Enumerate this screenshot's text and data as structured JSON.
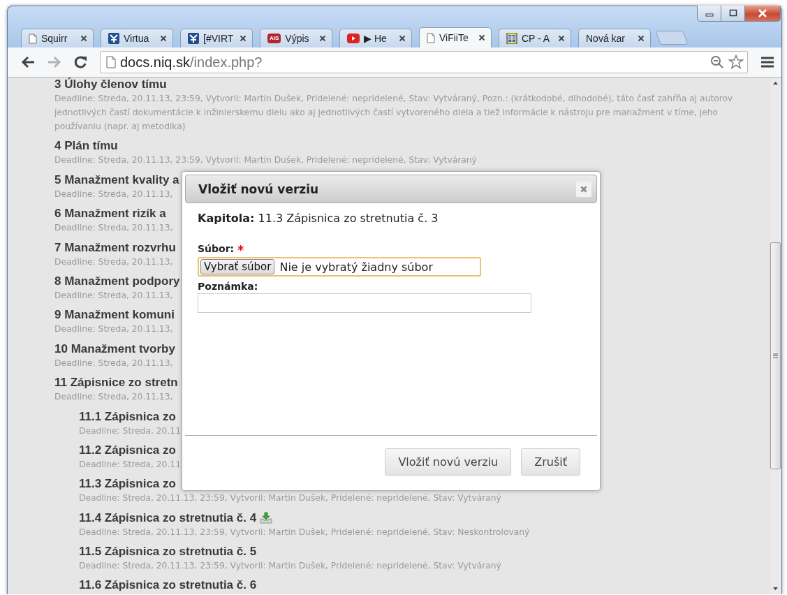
{
  "browser": {
    "tabs": [
      {
        "kind": "page",
        "label": "Squirr",
        "selected": false
      },
      {
        "kind": "mark",
        "label": "Virtua",
        "selected": false
      },
      {
        "kind": "mark",
        "label": "[#VIRT",
        "selected": false
      },
      {
        "kind": "badge",
        "badge": "AIS",
        "label": "Výpis",
        "selected": false
      },
      {
        "kind": "play",
        "label": "▶ He",
        "selected": false
      },
      {
        "kind": "page",
        "label": "ViFiiTe",
        "selected": true
      },
      {
        "kind": "sheet",
        "label": "CP - A",
        "selected": false
      },
      {
        "kind": "plain",
        "label": "Nová kar",
        "selected": false
      }
    ],
    "nav": [
      {
        "kind": "back",
        "disabled": false
      },
      {
        "kind": "forward",
        "disabled": true
      },
      {
        "kind": "reload",
        "disabled": false
      }
    ],
    "address": {
      "host": "docs.niq.sk",
      "path": "/index.php?"
    }
  },
  "chapters": [
    {
      "title": "3 Úlohy členov tímu",
      "deadline": "Deadline: Streda, 20.11.13, 23:59, Vytvoril: Martin Dušek, Pridelené: nepridelené, Stav: Vytváraný, Pozn.: (krátkodobé, dlhodobé), táto časť zahŕňa aj autorov jednotlivých častí dokumentácie k inžinierskemu dielu ako aj jednotlivých častí vytvoreného diela a tiež informácie k nástroju pre manažment v tíme, jeho používaniu (napr. aj metodika)",
      "has_file": false
    },
    {
      "title": "4 Plán tímu",
      "deadline": "Deadline: Streda, 20.11.13, 23:59, Vytvoril: Martin Dušek, Pridelené: nepridelené, Stav: Vytváraný",
      "has_file": false
    },
    {
      "title": "5 Manažment kvality a",
      "deadline": "Deadline: Streda, 20.11.13,",
      "has_file": false
    },
    {
      "title": "6 Manažment rizík a",
      "deadline": "Deadline: Streda, 20.11.13,",
      "has_file": false
    },
    {
      "title": "7 Manažment rozvrhu",
      "deadline": "Deadline: Streda, 20.11.13,",
      "has_file": false
    },
    {
      "title": "8 Manažment podpory",
      "deadline": "Deadline: Streda, 20.11.13,",
      "has_file": false
    },
    {
      "title": "9 Manažment komuni",
      "deadline": "Deadline: Streda, 20.11.13,",
      "has_file": false
    },
    {
      "title": "10 Manažment tvorby",
      "deadline": "Deadline: Streda, 20.11.13,",
      "has_file": false
    },
    {
      "title": "11 Zápisnice zo stretn",
      "deadline": "Deadline: Streda, 20.11.13,",
      "has_file": false,
      "children": [
        {
          "title": "11.1 Zápisnica zo",
          "deadline": "Deadline: Streda, 20.11",
          "has_file": false
        },
        {
          "title": "11.2 Zápisnica zo",
          "deadline": "Deadline: Streda, 20.11",
          "has_file": false
        },
        {
          "title": "11.3 Zápisnica zo",
          "deadline": "Deadline: Streda, 20.11.13, 23:59, Vytvoril: Martin Dušek, Pridelené: nepridelené, Stav: Vytváraný",
          "has_file": false
        },
        {
          "title": "11.4 Zápisnica zo stretnutia č. 4",
          "deadline": "Deadline: Streda, 20.11.13, 23:59, Vytvoril: Martin Dušek, Pridelené: nepridelené, Stav: Neskontrolovaný",
          "has_file": true
        },
        {
          "title": "11.5 Zápisnica zo stretnutia č. 5",
          "deadline": "Deadline: Streda, 20.11.13, 23:59, Vytvoril: Martin Dušek, Pridelené: nepridelené, Stav: Vytváraný",
          "has_file": false
        },
        {
          "title": "11.6 Zápisnica zo stretnutia č. 6",
          "has_file": false
        }
      ]
    }
  ],
  "dialog": {
    "title": "Vložiť novú verziu",
    "chapter": "**Kapitola:** 11.3 Zápisnica zo stretnutia č. 3",
    "required_mark": "*",
    "fields": [
      {
        "kind": "file",
        "label": "Súbor:",
        "required": true,
        "focused": true,
        "button": "Vybrať súbor",
        "value": "Nie je vybratý žiadny súbor"
      },
      {
        "kind": "text",
        "label": "Poznámka:",
        "required": false,
        "focused": false
      }
    ],
    "buttons": [
      {
        "label": "Vložiť novú verziu"
      },
      {
        "label": "Zrušiť"
      }
    ]
  }
}
